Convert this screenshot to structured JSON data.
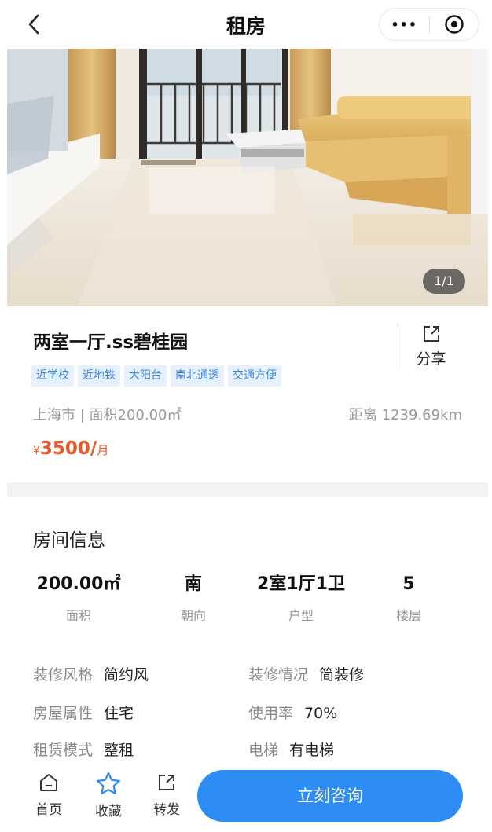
{
  "header": {
    "title": "租房",
    "more_glyph": "•••"
  },
  "photo": {
    "counter": "1/1"
  },
  "listing": {
    "title": "两室一厅.ss碧桂园",
    "tags": [
      "近学校",
      "近地铁",
      "大阳台",
      "南北通透",
      "交通方便"
    ],
    "share_label": "分享",
    "meta": "上海市 | 面积200.00㎡",
    "distance": "距离 1239.69km",
    "price_currency": "¥",
    "price_amount": "3500/",
    "price_unit": "月"
  },
  "room_info": {
    "title": "房间信息",
    "stats": [
      {
        "value": "200.00㎡",
        "label": "面积"
      },
      {
        "value": "南",
        "label": "朝向"
      },
      {
        "value": "2室1厅1卫",
        "label": "户型"
      },
      {
        "value": "5",
        "label": "楼层"
      }
    ],
    "attributes": [
      {
        "label": "装修风格",
        "value": "简约风"
      },
      {
        "label": "装修情况",
        "value": "简装修"
      },
      {
        "label": "房屋属性",
        "value": "住宅"
      },
      {
        "label": "使用率",
        "value": "70%"
      },
      {
        "label": "租赁模式",
        "value": "整租"
      },
      {
        "label": "电梯",
        "value": "有电梯"
      }
    ]
  },
  "bottom_bar": {
    "home_label": "首页",
    "favorite_label": "收藏",
    "forward_label": "转发",
    "consult_label": "立刻咨询"
  },
  "colors": {
    "accent_blue": "#2e8df4",
    "price_orange": "#e8582b",
    "tag_bg": "#e6f1fd",
    "tag_text": "#3e86d6"
  }
}
